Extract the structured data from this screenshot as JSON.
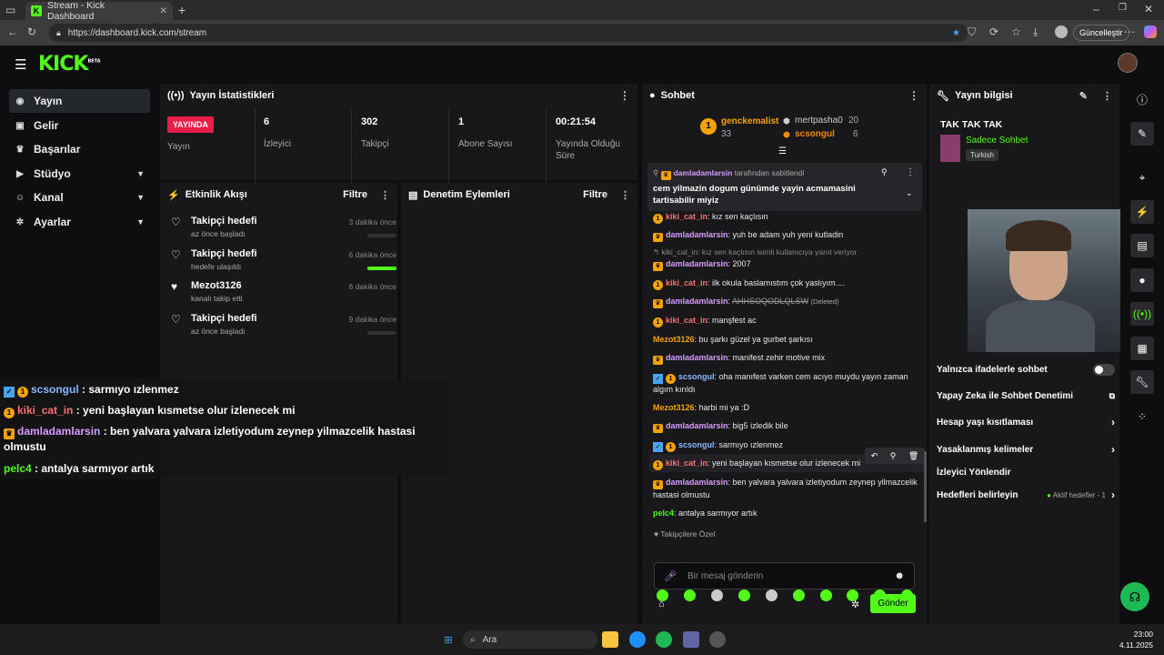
{
  "browser": {
    "tab_title": "Stream - Kick Dashboard",
    "url": "https://dashboard.kick.com/stream",
    "update_label": "Güncelleştir"
  },
  "brand": {
    "logo": "KICK",
    "badge": "BETA",
    "accent": "#53fc18"
  },
  "sidebar": {
    "items": [
      {
        "label": "Yayın"
      },
      {
        "label": "Gelir"
      },
      {
        "label": "Başarılar"
      },
      {
        "label": "Stüdyo"
      },
      {
        "label": "Kanal"
      },
      {
        "label": "Ayarlar"
      }
    ]
  },
  "stats": {
    "title": "Yayın İstatistikleri",
    "live_badge": "YAYINDA",
    "live_label": "Yayın",
    "items": [
      {
        "value": "6",
        "label": "İzleyici"
      },
      {
        "value": "302",
        "label": "Takipçi"
      },
      {
        "value": "1",
        "label": "Abone Sayısı"
      },
      {
        "value": "00:21:54",
        "label": "Yayında Olduğu Süre"
      }
    ]
  },
  "activity": {
    "title": "Etkinlik Akışı",
    "filter": "Filtre",
    "items": [
      {
        "title": "Takipçi hedefi",
        "sub": "az önce başladı",
        "time": "3 dakika önce"
      },
      {
        "title": "Takipçi hedefi",
        "sub": "hedefe ulaşıldı",
        "time": "6 dakika önce"
      },
      {
        "title": "Mezot3126",
        "sub": "kanalı takip etti",
        "time": "6 dakika önce"
      },
      {
        "title": "Takipçi hedefi",
        "sub": "az önce başladı",
        "time": "9 dakika önce"
      }
    ]
  },
  "moderation": {
    "title": "Denetim Eylemleri",
    "filter": "Filtre"
  },
  "chat": {
    "title": "Sohbet",
    "leaders": {
      "rank": "1",
      "first": {
        "name": "genckemalist",
        "count": "33"
      },
      "second": {
        "name": "mertpasha0",
        "count": "20"
      },
      "third": {
        "name": "scsongul",
        "count": "6"
      }
    },
    "pinned": {
      "by": "damladamlarsin",
      "by_suffix": "tarafından sabitlendi",
      "text": "cem yilmazin dogum günümde yayin acmamasini tartisabilir miyiz"
    },
    "messages": [
      {
        "user": "kiki_cat_in",
        "text": "kız sen kaçlısın"
      },
      {
        "user": "damladamlarsin",
        "text": "yuh be adam yuh yeni kutladin"
      },
      {
        "reply": "kiki_cat_in: kız sen kaçlısın isimli kullanıcıya yanıt veriyor"
      },
      {
        "user": "damladamlarsin",
        "text": "2007"
      },
      {
        "user": "kiki_cat_in",
        "text": "ilk okula baslamıstım çok yaslıyım...."
      },
      {
        "user": "damladamlarsin",
        "text": "AHHSOQODLQLSW",
        "deleted": "(Deleted)"
      },
      {
        "user": "kiki_cat_in",
        "text": "manşfest ac"
      },
      {
        "user": "Mezot3126",
        "text": "bu şarkı güzel ya gurbet şarkısı"
      },
      {
        "user": "damladamlarsin",
        "text": "manifest zehir motive mix"
      },
      {
        "user": "scsongul",
        "text": "oha manıfest varken cem acıyo muydu yayın zaman algım kırıldı"
      },
      {
        "user": "Mezot3126",
        "text": "harbi mi ya :D"
      },
      {
        "user": "damladamlarsin",
        "text": "big5 izledik bile"
      },
      {
        "user": "scsongul",
        "text": "sarmıyo ızlenmez"
      },
      {
        "user": "kiki_cat_in",
        "text": "yeni başlayan kısmetse olur izlenecek mi"
      },
      {
        "user": "damladamlarsin",
        "text": "ben yalvara yalvara izletiyodum zeynep yilmazcelik hastasi olmustu"
      },
      {
        "user": "pelc4",
        "text": "antalya sarmıyor artık"
      }
    ],
    "followers_only": "Takipçilere Özel",
    "input_placeholder": "Bir mesaj gönderin",
    "send": "Gönder"
  },
  "overlay": [
    {
      "user": "scsongul",
      "text": "sarmıyo ızlenmez"
    },
    {
      "user": "kiki_cat_in",
      "text": "yeni başlayan kısmetse olur izlenecek mi"
    },
    {
      "user": "damladamlarsin",
      "text": "ben yalvara yalvara izletiyodum zeynep yilmazcelik hastasi olmustu"
    },
    {
      "user": "pelc4",
      "text": "antalya sarmıyor artık"
    }
  ],
  "info": {
    "title": "Yayın bilgisi",
    "stream_title": "TAK TAK TAK",
    "category": "Sadece Sohbet",
    "language": "Turkish",
    "settings": [
      {
        "label": "Yalnızca ifadelerle sohbet"
      },
      {
        "label": "Yapay Zeka ile Sohbet Denetimi"
      },
      {
        "label": "Hesap yaşı kısıtlaması"
      },
      {
        "label": "Yasaklanmış kelimeler"
      },
      {
        "label": "İzleyici Yönlendir"
      },
      {
        "label": "Hedefleri belirleyin",
        "extra": "Aktif hedefler - 1"
      }
    ]
  },
  "taskbar": {
    "search": "Ara",
    "time": "23:00",
    "date": "4.11.2025"
  },
  "colors": {
    "kiki": "#ff6e6e",
    "damla": "#d79cff",
    "mezot": "#f5a300",
    "scsongul": "#8ab8ff",
    "pelc4": "#53fc18",
    "live": "#e91e47"
  }
}
